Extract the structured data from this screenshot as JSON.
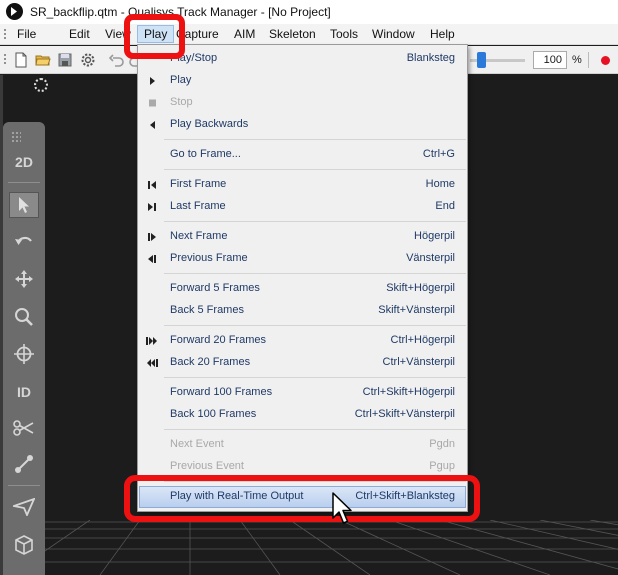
{
  "window": {
    "title": "SR_backflip.qtm - Qualisys Track Manager - [No Project]"
  },
  "menubar": {
    "items": [
      "File",
      "Edit",
      "View",
      "Play",
      "Capture",
      "AIM",
      "Skeleton",
      "Tools",
      "Window",
      "Help"
    ],
    "active": "Play"
  },
  "toolbar": {
    "zoom_value": "100",
    "zoom_unit": "%",
    "record_color": "#e81123"
  },
  "tools": {
    "mode_2d_label": "2D",
    "identify_label": "ID",
    "icons": [
      "drag-grip-icon",
      "2d-view-icon",
      "select-arrow-icon",
      "rotate-icon",
      "translate-icon",
      "zoom-icon",
      "center-icon",
      "identify-icon",
      "cut-trajectory-icon",
      "bone-icon",
      "fill-icon",
      "cube-icon"
    ]
  },
  "play_menu": {
    "items": [
      {
        "label": "Play/Stop",
        "shortcut": "Blanksteg",
        "icon": "none",
        "enabled": true
      },
      {
        "label": "Play",
        "shortcut": "",
        "icon": "play-triangle-icon",
        "enabled": true
      },
      {
        "label": "Stop",
        "shortcut": "",
        "icon": "stop-square-icon",
        "enabled": false
      },
      {
        "label": "Play Backwards",
        "shortcut": "",
        "icon": "play-backwards-icon",
        "enabled": true
      },
      {
        "label": "Go to Frame...",
        "shortcut": "Ctrl+G",
        "icon": "none",
        "enabled": true
      },
      {
        "label": "First Frame",
        "shortcut": "Home",
        "icon": "first-frame-icon",
        "enabled": true
      },
      {
        "label": "Last Frame",
        "shortcut": "End",
        "icon": "last-frame-icon",
        "enabled": true
      },
      {
        "label": "Next Frame",
        "shortcut": "Högerpil",
        "icon": "next-frame-icon",
        "enabled": true
      },
      {
        "label": "Previous Frame",
        "shortcut": "Vänsterpil",
        "icon": "previous-frame-icon",
        "enabled": true
      },
      {
        "label": "Forward 5 Frames",
        "shortcut": "Skift+Högerpil",
        "icon": "none",
        "enabled": true
      },
      {
        "label": "Back 5 Frames",
        "shortcut": "Skift+Vänsterpil",
        "icon": "none",
        "enabled": true
      },
      {
        "label": "Forward 20 Frames",
        "shortcut": "Ctrl+Högerpil",
        "icon": "forward-20-icon",
        "enabled": true
      },
      {
        "label": "Back 20 Frames",
        "shortcut": "Ctrl+Vänsterpil",
        "icon": "back-20-icon",
        "enabled": true
      },
      {
        "label": "Forward 100 Frames",
        "shortcut": "Ctrl+Skift+Högerpil",
        "icon": "none",
        "enabled": true
      },
      {
        "label": "Back 100 Frames",
        "shortcut": "Ctrl+Skift+Vänsterpil",
        "icon": "none",
        "enabled": true
      },
      {
        "label": "Next Event",
        "shortcut": "Pgdn",
        "icon": "none",
        "enabled": false
      },
      {
        "label": "Previous Event",
        "shortcut": "Pgup",
        "icon": "none",
        "enabled": false
      },
      {
        "label": "Play with Real-Time Output",
        "shortcut": "Ctrl+Skift+Blanksteg",
        "icon": "none",
        "enabled": true,
        "hovered": true
      }
    ]
  },
  "colors": {
    "highlight": "#ee1111",
    "menu_text": "#1f3a66",
    "disabled_text": "#a8a8a8",
    "accent": "#2b7ad9"
  }
}
